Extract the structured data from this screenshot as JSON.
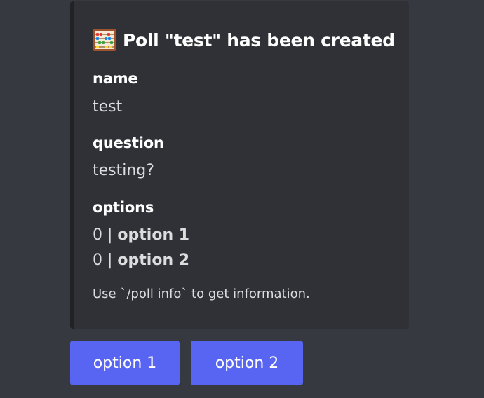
{
  "embed": {
    "icon": "abacus-icon",
    "title": "Poll \"test\" has been created",
    "fields": {
      "name": {
        "label": "name",
        "value": "test"
      },
      "question": {
        "label": "question",
        "value": "testing?"
      },
      "options": {
        "label": "options",
        "items": [
          {
            "count": "0",
            "separator": "|",
            "label": "option 1"
          },
          {
            "count": "0",
            "separator": "|",
            "label": "option 2"
          }
        ]
      }
    },
    "footer": "Use `/poll info` to get information."
  },
  "buttons": [
    {
      "label": "option 1"
    },
    {
      "label": "option 2"
    }
  ],
  "colors": {
    "background": "#36393f",
    "embed_background": "#2f3136",
    "embed_accent": "#202225",
    "button": "#5865f2"
  }
}
